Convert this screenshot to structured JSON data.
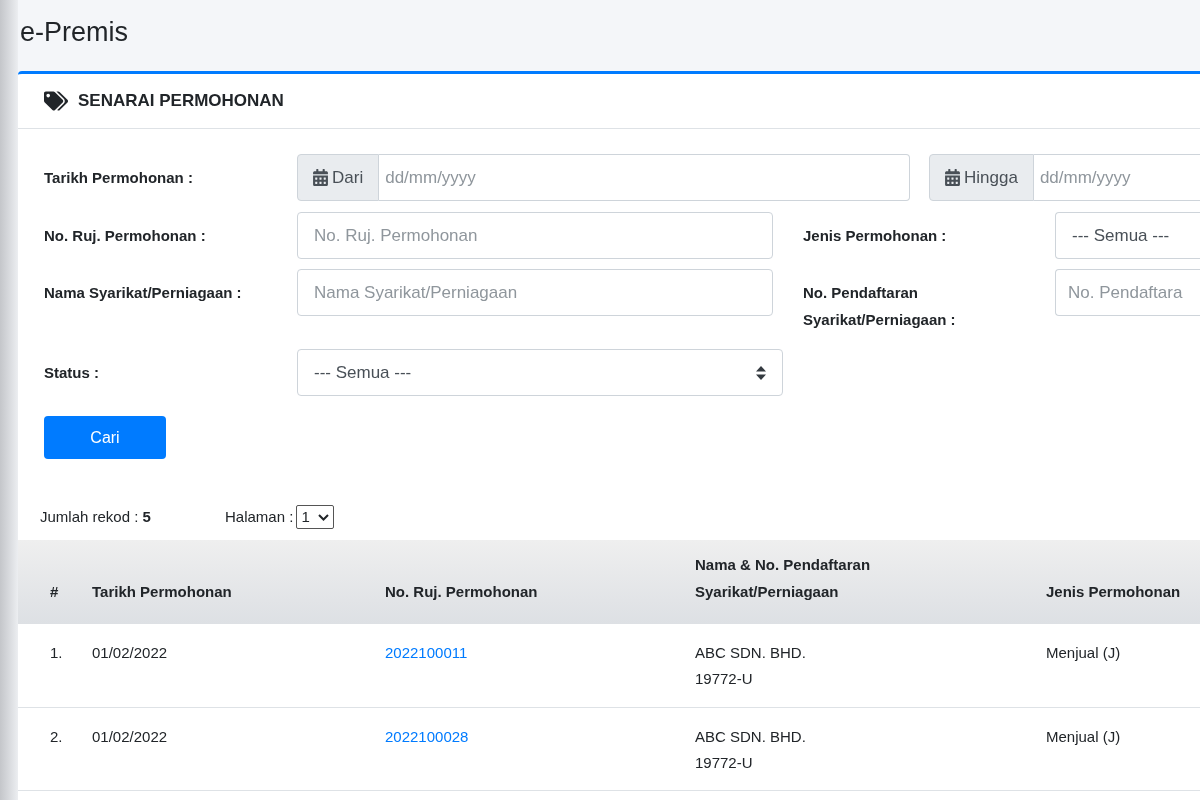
{
  "page_title": "e-Premis",
  "card": {
    "title": "SENARAI PERMOHONAN"
  },
  "form": {
    "date_label": "Tarikh Permohonan :",
    "date_from": {
      "addon": "Dari",
      "placeholder": "dd/mm/yyyy"
    },
    "date_to": {
      "addon": "Hingga",
      "placeholder": "dd/mm/yyyy"
    },
    "ref": {
      "label": "No. Ruj. Permohonan :",
      "placeholder": "No. Ruj. Permohonan"
    },
    "type": {
      "label": "Jenis Permohonan :",
      "value": "--- Semua ---"
    },
    "company": {
      "label": "Nama Syarikat/Perniagaan :",
      "placeholder": "Nama Syarikat/Perniagaan"
    },
    "reg_no": {
      "label": "No. Pendaftaran Syarikat/Perniagaan :",
      "placeholder": "No. Pendaftara"
    },
    "status": {
      "label": "Status :",
      "value": "--- Semua ---"
    },
    "search_button": "Cari"
  },
  "records": {
    "label": "Jumlah rekod :",
    "count": "5"
  },
  "pagination": {
    "label": "Halaman :",
    "value": "1"
  },
  "table": {
    "columns": [
      "#",
      "Tarikh Permohonan",
      "No. Ruj. Permohonan",
      "Nama & No. Pendaftaran Syarikat/Perniagaan",
      "Jenis Permohonan"
    ],
    "rows": [
      {
        "no": "1.",
        "date": "01/02/2022",
        "ref": "2022100011",
        "company": "ABC SDN. BHD.",
        "reg_no": "19772-U",
        "type": "Menjual (J)"
      },
      {
        "no": "2.",
        "date": "01/02/2022",
        "ref": "2022100028",
        "company": "ABC SDN. BHD.",
        "reg_no": "19772-U",
        "type": "Menjual (J)"
      }
    ]
  }
}
